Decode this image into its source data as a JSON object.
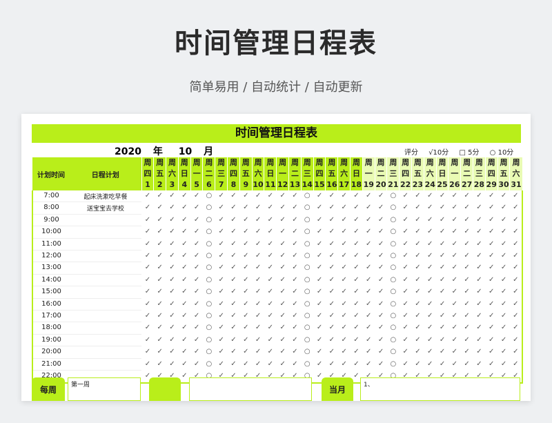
{
  "page": {
    "title": "时间管理日程表",
    "subtitle": "简单易用 / 自动统计 / 自动更新"
  },
  "sheet": {
    "title": "时间管理日程表",
    "year": "2020",
    "year_label": "年",
    "month": "10",
    "month_label": "月",
    "legend": {
      "label": "评分",
      "check": "√10分",
      "square": "□ 5分",
      "circle": "○ 10分"
    },
    "col_time": "计划时间",
    "col_plan": "日程计划",
    "weekday_label": "周",
    "weekdays": [
      "四",
      "五",
      "六",
      "日",
      "一",
      "二",
      "三",
      "四",
      "五",
      "六",
      "日",
      "一",
      "二",
      "三",
      "四",
      "五",
      "六",
      "日",
      "一",
      "二",
      "三",
      "四",
      "五",
      "六",
      "日",
      "一",
      "二",
      "三",
      "四",
      "五",
      "六"
    ],
    "days": [
      "1",
      "2",
      "3",
      "4",
      "5",
      "6",
      "7",
      "8",
      "9",
      "10",
      "11",
      "12",
      "13",
      "14",
      "15",
      "16",
      "17",
      "18",
      "19",
      "20",
      "21",
      "22",
      "23",
      "24",
      "25",
      "26",
      "27",
      "28",
      "29",
      "30",
      "31"
    ],
    "rows": [
      {
        "time": "7:00",
        "plan": "起床洗漱吃早餐"
      },
      {
        "time": "8:00",
        "plan": "送宝宝去学校"
      },
      {
        "time": "9:00",
        "plan": ""
      },
      {
        "time": "10:00",
        "plan": ""
      },
      {
        "time": "11:00",
        "plan": ""
      },
      {
        "time": "12:00",
        "plan": ""
      },
      {
        "time": "13:00",
        "plan": ""
      },
      {
        "time": "14:00",
        "plan": ""
      },
      {
        "time": "15:00",
        "plan": ""
      },
      {
        "time": "16:00",
        "plan": ""
      },
      {
        "time": "17:00",
        "plan": ""
      },
      {
        "time": "18:00",
        "plan": ""
      },
      {
        "time": "19:00",
        "plan": ""
      },
      {
        "time": "20:00",
        "plan": ""
      },
      {
        "time": "21:00",
        "plan": ""
      },
      {
        "time": "22:00",
        "plan": ""
      }
    ],
    "check_mark": "✓",
    "circle_mark": "○",
    "circle_day_indices": [
      5,
      13,
      20
    ],
    "footer": {
      "weekly_label": "每周",
      "week_one": "第一周",
      "monthly_label": "当月",
      "monthly_note": "1、"
    }
  }
}
